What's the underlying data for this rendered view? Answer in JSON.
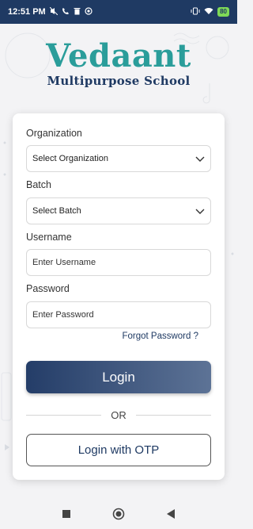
{
  "status_bar": {
    "time": "12:51 PM",
    "battery": "80",
    "left_icons": [
      "mute-icon",
      "phone-off-icon",
      "delete-icon",
      "notification-badge-icon"
    ],
    "right_icons": [
      "vibrate-icon",
      "wifi-icon",
      "battery-icon"
    ]
  },
  "brand": {
    "name": "Vedaant",
    "subtitle": "Multipurpose School"
  },
  "form": {
    "organization_label": "Organization",
    "organization_value": "Select Organization",
    "batch_label": "Batch",
    "batch_value": "Select Batch",
    "username_label": "Username",
    "username_placeholder": "Enter Username",
    "password_label": "Password",
    "password_placeholder": "Enter Password",
    "forgot_password": "Forgot Password ?",
    "login_button": "Login",
    "or_text": "OR",
    "otp_button": "Login with OTP"
  },
  "colors": {
    "brand_teal": "#2a9d9a",
    "brand_navy": "#1f3a63",
    "status_bar": "#1f3a63"
  },
  "nav_bar": {
    "icons": [
      "recents-square-icon",
      "home-circle-icon",
      "back-triangle-icon"
    ]
  }
}
